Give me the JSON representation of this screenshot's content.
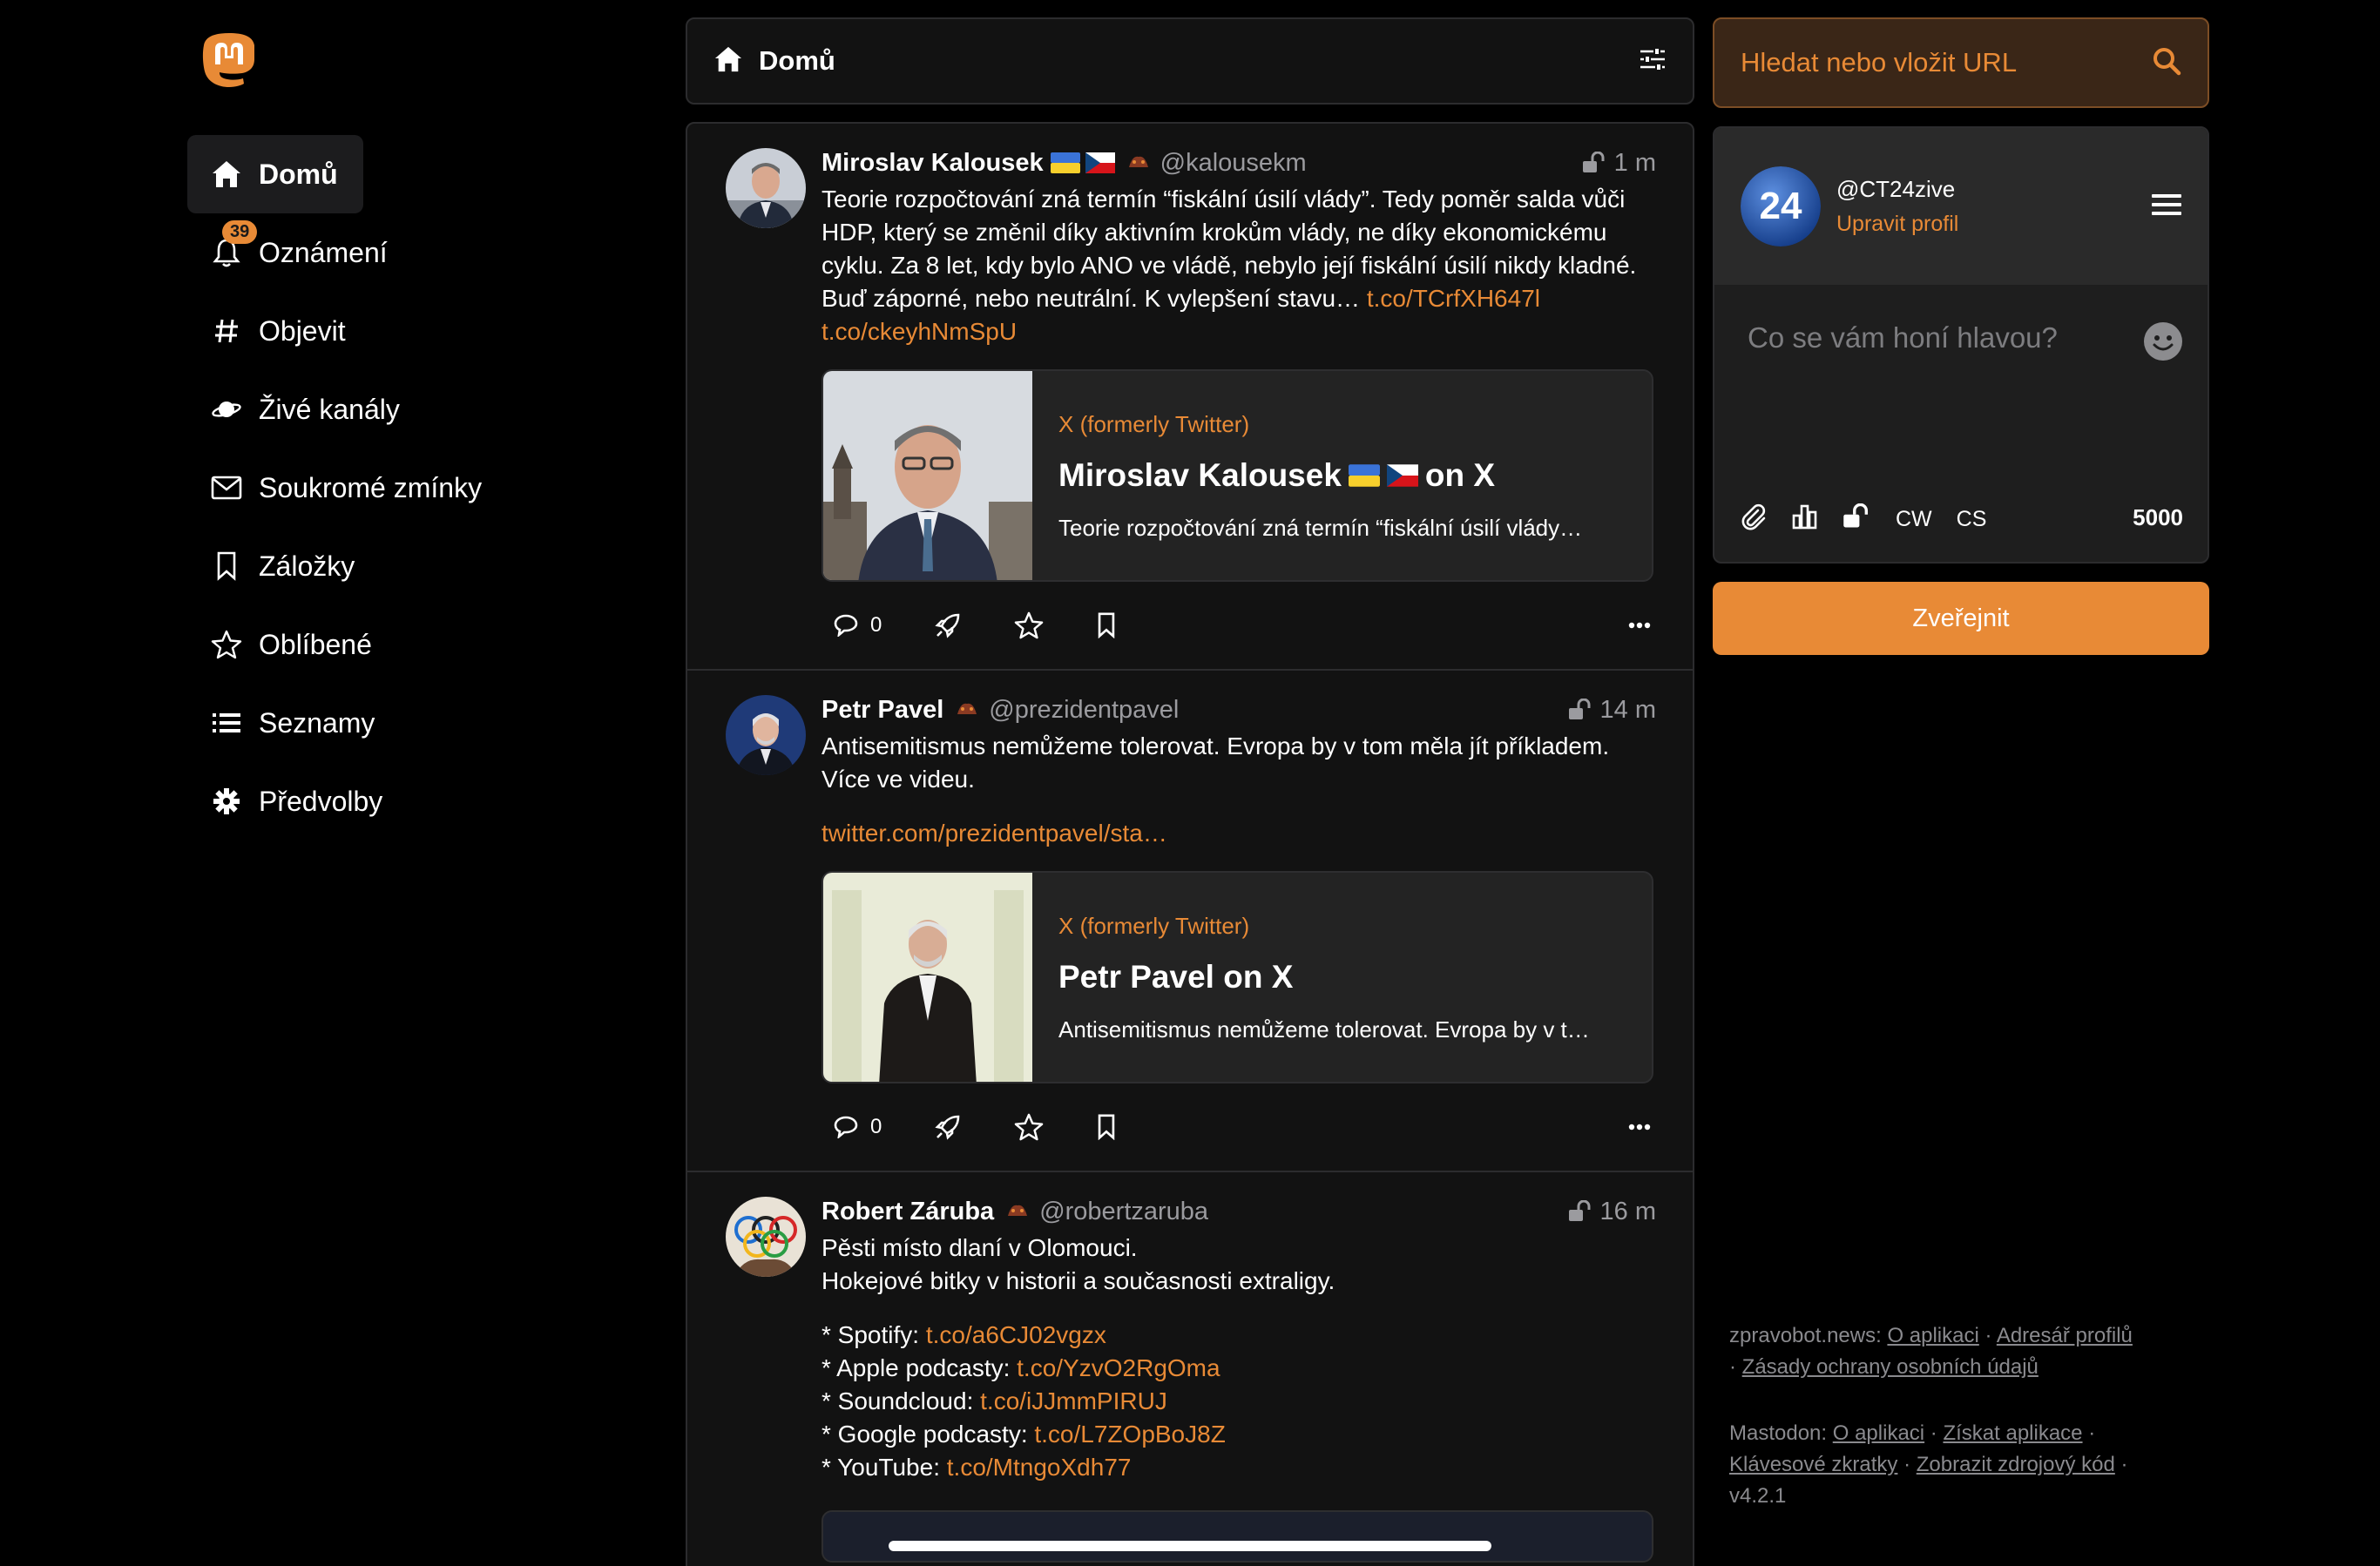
{
  "app": {
    "name": "Mastodon"
  },
  "nav": {
    "items": [
      {
        "label": "Domů",
        "icon": "home-icon"
      },
      {
        "label": "Oznámení",
        "icon": "bell-icon",
        "badge": "39"
      },
      {
        "label": "Objevit",
        "icon": "hashtag-icon"
      },
      {
        "label": "Živé kanály",
        "icon": "planet-icon"
      },
      {
        "label": "Soukromé zmínky",
        "icon": "envelope-icon"
      },
      {
        "label": "Záložky",
        "icon": "bookmark-icon"
      },
      {
        "label": "Oblíbené",
        "icon": "star-icon"
      },
      {
        "label": "Seznamy",
        "icon": "list-icon"
      },
      {
        "label": "Předvolby",
        "icon": "gear-icon"
      }
    ]
  },
  "header": {
    "title": "Domů"
  },
  "posts": [
    {
      "name": "Miroslav Kalousek",
      "handle": "@kalousekm",
      "time": "1 m",
      "text": "Teorie rozpočtování zná termín “fiskální úsilí vlády”. Tedy poměr salda vůči HDP, který se změnil díky aktivním krokům vlády, ne díky ekonomickému cyklu. Za 8 let, kdy bylo ANO ve vládě, nebylo její fiskální úsilí nikdy kladné. Buď záporné, nebo neutrální. K vylepšení stavu… ",
      "link1": "t.co/TCrfXH647l",
      "link2": "t.co/ckeyhNmSpU",
      "card": {
        "provider": "X (formerly Twitter)",
        "title_a": "Miroslav Kalousek",
        "title_b": "on X",
        "desc": "Teorie rozpočtování zná termín “fiskální úsilí vlády…"
      },
      "replies": "0"
    },
    {
      "name": "Petr Pavel",
      "handle": "@prezidentpavel",
      "time": "14 m",
      "text": "Antisemitismus nemůžeme tolerovat. Evropa by v tom měla jít příkladem. Více ve videu.",
      "link": "twitter.com/prezidentpavel/sta…",
      "card": {
        "provider": "X (formerly Twitter)",
        "title": "Petr Pavel on X",
        "desc": "Antisemitismus nemůžeme tolerovat. Evropa by v t…"
      },
      "replies": "0"
    },
    {
      "name": "Robert Záruba",
      "handle": "@robertzaruba",
      "time": "16 m",
      "line1": "Pěsti místo dlaní v Olomouci.",
      "line2": "Hokejové bitky v historii a současnosti extraligy.",
      "items": [
        {
          "label": "* Spotify: ",
          "link": "t.co/a6CJ02vgzx"
        },
        {
          "label": "* Apple podcasty: ",
          "link": "t.co/YzvO2RgOma"
        },
        {
          "label": "* Soundcloud: ",
          "link": "t.co/iJJmmPIRUJ"
        },
        {
          "label": "* Google podcasty: ",
          "link": "t.co/L7ZOpBoJ8Z"
        },
        {
          "label": "* YouTube: ",
          "link": "t.co/MtngoXdh77"
        }
      ]
    }
  ],
  "search": {
    "placeholder": "Hledat nebo vložit URL"
  },
  "compose": {
    "account": "@CT24zive",
    "avatar_text": "24",
    "edit_profile": "Upravit profil",
    "placeholder": "Co se vám honí hlavou?",
    "cw": "CW",
    "lang": "CS",
    "char_count": "5000",
    "publish": "Zveřejnit"
  },
  "footer": {
    "server_label": "zpravobot.news:",
    "server_links": [
      "O aplikaci",
      "Adresář profilů",
      "Zásady ochrany osobních údajů"
    ],
    "mastodon_label": "Mastodon:",
    "mastodon_links": [
      "O aplikaci",
      "Získat aplikace",
      "Klávesové zkratky",
      "Zobrazit zdrojový kód"
    ],
    "version": "v4.2.1"
  },
  "colors": {
    "accent": "#e88a36",
    "background": "#000000",
    "panel": "#121212",
    "border": "#2c2c2e",
    "muted": "#9b9b9f"
  }
}
